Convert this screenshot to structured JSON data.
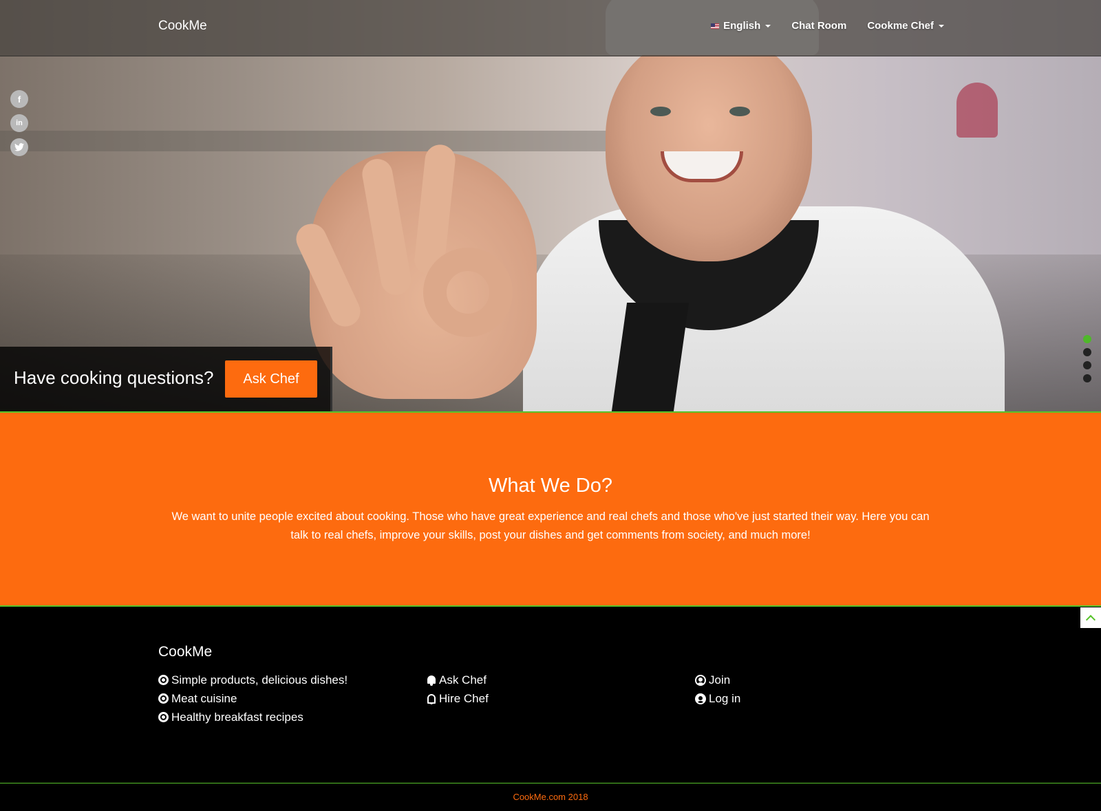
{
  "navbar": {
    "brand": "CookMe",
    "items": [
      {
        "label": "English",
        "has_dropdown": true,
        "icon": "us-flag-icon"
      },
      {
        "label": "Chat Room",
        "has_dropdown": false
      },
      {
        "label": "Cookme Chef",
        "has_dropdown": true
      }
    ]
  },
  "social": [
    {
      "icon": "facebook-icon",
      "glyph": "f"
    },
    {
      "icon": "linkedin-icon",
      "glyph": "in"
    },
    {
      "icon": "twitter-icon",
      "glyph": "t"
    }
  ],
  "hero": {
    "question": "Have cooking questions?",
    "ask_button": "Ask Chef",
    "slides": 4,
    "active_slide": 1
  },
  "about": {
    "title": "What We Do?",
    "text": "We want to unite people excited about cooking. Those who have great experience and real chefs and those who've just started their way. Here you can talk to real chefs, improve your skills, post your dishes and get comments from society, and much more!"
  },
  "footer": {
    "brand": "CookMe",
    "col1": [
      "Simple products, delicious dishes!",
      "Meat cuisine",
      "Healthy breakfast recipes"
    ],
    "col2": [
      "Ask Chef",
      "Hire Chef"
    ],
    "col3": [
      "Join",
      "Log in"
    ],
    "copyright": "CookMe.com 2018"
  },
  "colors": {
    "accent_orange": "#fd6b0f",
    "accent_green": "#57c32a",
    "footer_bg": "#000000"
  }
}
